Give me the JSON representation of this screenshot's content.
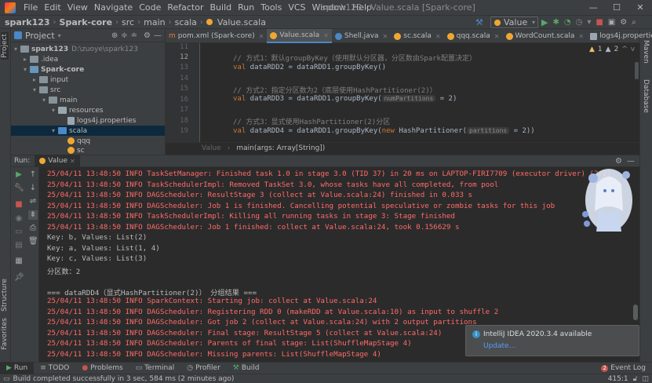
{
  "app": {
    "menu": [
      "File",
      "Edit",
      "View",
      "Navigate",
      "Code",
      "Refactor",
      "Build",
      "Run",
      "Tools",
      "VCS",
      "Window",
      "Help"
    ],
    "window_title": "spark123 - Value.scala [Spark-core]",
    "min_glyph": "—",
    "max_glyph": "☐",
    "close_glyph": "✕"
  },
  "navbar": {
    "crumbs": [
      "spark123",
      "Spark-core",
      "src",
      "main",
      "scala",
      "Value.scala"
    ],
    "run_config": "Value"
  },
  "left_tool": {
    "project": "Project",
    "structure": "Structure",
    "favorites": "Favorites"
  },
  "right_tool": {
    "maven": "Maven",
    "database": "Database"
  },
  "project_panel": {
    "title": "Project",
    "rows": [
      {
        "label": "spark123",
        "extra": "D:\\zuoye\\spark123"
      },
      {
        "label": ".idea"
      },
      {
        "label": "Spark-core"
      },
      {
        "label": "input"
      },
      {
        "label": "src"
      },
      {
        "label": "main"
      },
      {
        "label": "resources"
      },
      {
        "label": "logs4j.properties"
      },
      {
        "label": "scala"
      },
      {
        "label": "qqq"
      },
      {
        "label": "sc"
      }
    ]
  },
  "editor_tabs": [
    "pom.xml (Spark-core)",
    "Value.scala",
    "Shell.java",
    "sc.scala",
    "qqq.scala",
    "WordCount.scala",
    "logs4j.properties"
  ],
  "editor": {
    "line_numbers": [
      "11",
      "12",
      "13",
      "14",
      "15",
      "16",
      "17",
      "18",
      "19"
    ],
    "lines": {
      "l12_comment": "// 方式1：默认groupByKey（使用默认分区器，分区数由Spark配置决定）",
      "l13_kw": "val",
      "l13_rest": " dataRDD2 = dataRDD1.groupByKey()",
      "l15_comment": "// 方式2：指定分区数为2（底层使用HashPartitioner(2)）",
      "l16_kw": "val",
      "l16_rest": " dataRDD3 = dataRDD1.groupByKey(",
      "l16_hint": "numPartitions",
      "l16_end": " = 2)",
      "l18_comment": "// 方式3：显式使用HashPartitioner(2)分区",
      "l19_kw": "val",
      "l19_rest": " dataRDD4 = dataRDD1.groupByKey(",
      "l19_new": "new",
      "l19_mid": " HashPartitioner(",
      "l19_hint": "partitions",
      "l19_end": " = 2))"
    },
    "inspection": {
      "warnings": "1",
      "weak": "2"
    },
    "breadcrumb_object": "Value",
    "breadcrumb_method": "main(args: Array[String])"
  },
  "run_panel": {
    "label": "Run:",
    "tab": "Value"
  },
  "console": [
    {
      "t": "25/04/11 13:48:50 INFO TaskSetManager: Finished task 1.0 in stage 3.0 (TID 37) in 20 ms on LAPTOP-FIRI7709 (executor driver) (2/2)",
      "red": true
    },
    {
      "t": "25/04/11 13:48:50 INFO TaskSchedulerImpl: Removed TaskSet 3.0, whose tasks have all completed, from pool",
      "red": true
    },
    {
      "t": "25/04/11 13:48:50 INFO DAGScheduler: ResultStage 3 (collect at Value.scala:24) finished in 0.033 s",
      "red": true
    },
    {
      "t": "25/04/11 13:48:50 INFO DAGScheduler: Job 1 is finished. Cancelling potential speculative or zombie tasks for this job",
      "red": true
    },
    {
      "t": "25/04/11 13:48:50 INFO TaskSchedulerImpl: Killing all running tasks in stage 3: Stage finished",
      "red": true
    },
    {
      "t": "25/04/11 13:48:50 INFO DAGScheduler: Job 1 finished: collect at Value.scala:24, took 0.156629 s",
      "red": true
    },
    {
      "t": "Key: b, Values: List(2)",
      "red": false
    },
    {
      "t": "Key: a, Values: List(1, 4)",
      "red": false
    },
    {
      "t": "Key: c, Values: List(3)",
      "red": false
    },
    {
      "t": "分区数：2",
      "red": false
    },
    {
      "t": "",
      "red": false
    },
    {
      "t": "=== dataRDD4（显式HashPartitioner(2)） 分组结果 ===",
      "red": false
    },
    {
      "t": "25/04/11 13:48:50 INFO SparkContext: Starting job: collect at Value.scala:24",
      "red": true
    },
    {
      "t": "25/04/11 13:48:50 INFO DAGScheduler: Registering RDD 0 (makeRDD at Value.scala:10) as input to shuffle 2",
      "red": true
    },
    {
      "t": "25/04/11 13:48:50 INFO DAGScheduler: Got job 2 (collect at Value.scala:24) with 2 output partitions",
      "red": true
    },
    {
      "t": "25/04/11 13:48:50 INFO DAGScheduler: Final stage: ResultStage 5 (collect at Value.scala:24)",
      "red": true
    },
    {
      "t": "25/04/11 13:48:50 INFO DAGScheduler: Parents of final stage: List(ShuffleMapStage 4)",
      "red": true
    },
    {
      "t": "25/04/11 13:48:50 INFO DAGScheduler: Missing parents: List(ShuffleMapStage 4)",
      "red": true
    }
  ],
  "notification": {
    "title": "IntelliJ IDEA 2020.3.4 available",
    "link": "Update..."
  },
  "bottom_tabs": [
    "Run",
    "TODO",
    "Problems",
    "Terminal",
    "Profiler",
    "Build"
  ],
  "event_log": "Event Log",
  "event_count": "2",
  "status": {
    "message": "Build completed successfully in 3 sec, 584 ms (2 minutes ago)",
    "position": "415:1"
  },
  "colors": {
    "background": "#2b2b2b",
    "panel": "#3c3f41",
    "log_red": "#ff6b68",
    "comment": "#808080",
    "keyword": "#cc7832",
    "accent": "#4a88c7"
  }
}
